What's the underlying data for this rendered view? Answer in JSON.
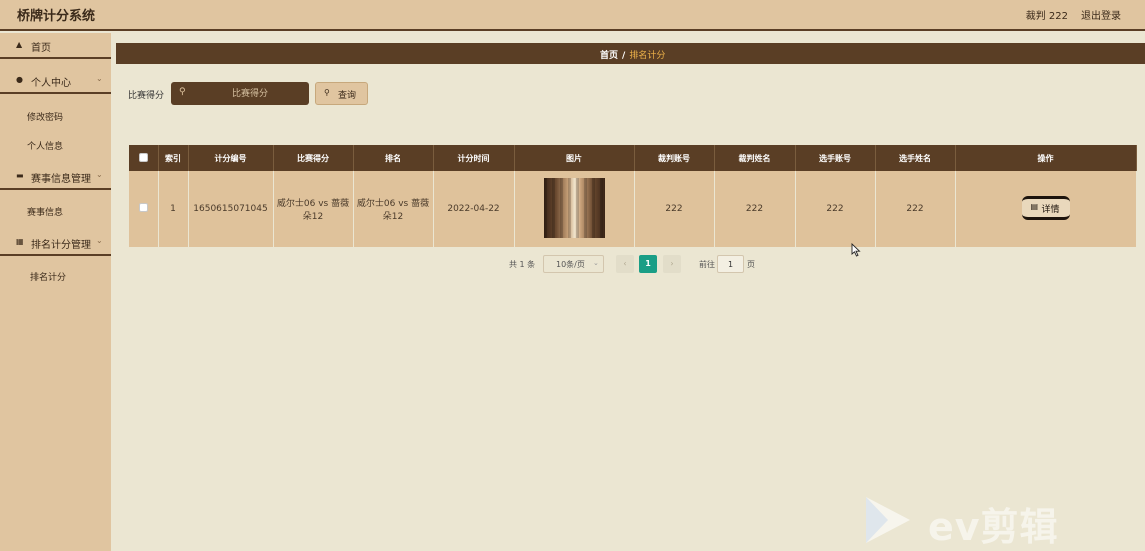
{
  "app": {
    "title": "桥牌计分系统"
  },
  "header": {
    "user": "裁判 222",
    "logout": "退出登录"
  },
  "sidebar": {
    "home": "首页",
    "personal": "个人中心",
    "personal_items": [
      "修改密码",
      "个人信息"
    ],
    "match_mgmt": "赛事信息管理",
    "match_items": [
      "赛事信息"
    ],
    "rank_mgmt": "排名计分管理",
    "rank_items": [
      "排名计分"
    ]
  },
  "breadcrumb": {
    "home": "首页",
    "separator": "/",
    "current": "排名计分"
  },
  "search": {
    "label": "比赛得分",
    "placeholder": "比赛得分",
    "button": "查询"
  },
  "table": {
    "headers": [
      "索引",
      "计分编号",
      "比赛得分",
      "排名",
      "计分时间",
      "图片",
      "裁判账号",
      "裁判姓名",
      "选手账号",
      "选手姓名",
      "操作"
    ],
    "rows": [
      {
        "index": "1",
        "score_id": "1650615071045",
        "match_score": "威尔士06 vs 蔷薇朵12",
        "rank": "威尔士06 vs 蔷薇朵12",
        "time": "2022-04-22",
        "referee_account": "222",
        "referee_name": "222",
        "player_account": "222",
        "player_name": "222",
        "action": "详情"
      }
    ]
  },
  "pagination": {
    "total": "共 1 条",
    "page_size": "10条/页",
    "current_page": "1",
    "goto_label": "前往",
    "goto_value": "1",
    "page_suffix": "页"
  },
  "watermark": {
    "text": "ev剪辑"
  },
  "colors": {
    "header_bg": "#e0c5a0",
    "accent_dark": "#5a3e25",
    "content_bg": "#ebe6d2",
    "active_page": "#1a9e86"
  }
}
